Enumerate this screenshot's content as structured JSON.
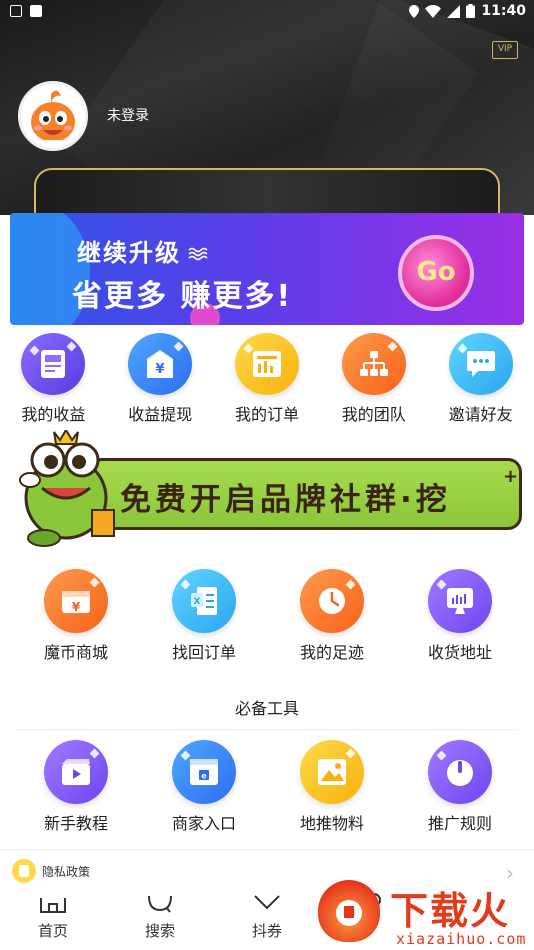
{
  "status_bar": {
    "time": "11:40",
    "battery": "1"
  },
  "header": {
    "vip_badge": "VIP",
    "login_text": "未登录"
  },
  "banner": {
    "line1": "继续升级",
    "line2": "省更多 赚更多!",
    "go_label": "Go"
  },
  "quick_menu": [
    {
      "label": "我的收益",
      "icon": "income-icon",
      "color": "#6a4cf0"
    },
    {
      "label": "收益提现",
      "icon": "withdraw-icon",
      "color": "#2f7ef2"
    },
    {
      "label": "我的订单",
      "icon": "orders-icon",
      "color": "#f6b20c"
    },
    {
      "label": "我的团队",
      "icon": "team-icon",
      "color": "#f5621a"
    },
    {
      "label": "邀请好友",
      "icon": "invite-icon",
      "color": "#2aa6ee"
    }
  ],
  "promo": {
    "text": "免费开启品牌社群·挖",
    "plus": "+"
  },
  "services": [
    {
      "label": "魔币商城",
      "icon": "coin-mall-icon"
    },
    {
      "label": "找回订单",
      "icon": "recover-order-icon"
    },
    {
      "label": "我的足迹",
      "icon": "footprint-clock-icon"
    },
    {
      "label": "收货地址",
      "icon": "address-icon"
    }
  ],
  "tools": {
    "title": "必备工具",
    "items": [
      {
        "label": "新手教程",
        "icon": "tutorial-video-icon"
      },
      {
        "label": "商家入口",
        "icon": "merchant-entry-icon"
      },
      {
        "label": "地推物料",
        "icon": "materials-image-icon"
      },
      {
        "label": "推广规则",
        "icon": "promotion-rules-icon"
      }
    ]
  },
  "privacy": {
    "label": "隐私政策"
  },
  "bottom_nav": {
    "items": [
      {
        "label": "首页",
        "icon": "home-icon"
      },
      {
        "label": "搜索",
        "icon": "search-icon"
      },
      {
        "label": "抖券",
        "icon": "coupon-icon"
      }
    ]
  },
  "watermark": {
    "title": "下载火",
    "url": "xiazaihuo.com"
  }
}
